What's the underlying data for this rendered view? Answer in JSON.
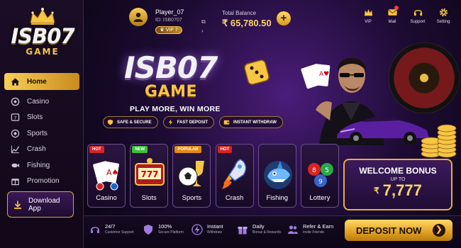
{
  "brand": {
    "logo_main": "ISB07",
    "logo_sub": "GAME"
  },
  "sidebar": {
    "items": [
      {
        "label": "Home",
        "icon": "home-icon",
        "active": true
      },
      {
        "label": "Casino",
        "icon": "casino-chip-icon"
      },
      {
        "label": "Slots",
        "icon": "slots-icon"
      },
      {
        "label": "Sports",
        "icon": "soccer-ball-icon"
      },
      {
        "label": "Crash",
        "icon": "chart-trend-icon"
      },
      {
        "label": "Fishing",
        "icon": "fish-icon"
      },
      {
        "label": "Promotion",
        "icon": "gift-icon"
      }
    ],
    "download_label_1": "Download",
    "download_label_2": "App"
  },
  "header": {
    "player_name": "Player_07",
    "player_id": "ID: ISB0707",
    "vip_level": "VIP 7",
    "balance_label": "Total Balance",
    "balance_value": "₹ 65,780.50",
    "add_label": "+",
    "icons": [
      {
        "label": "VIP",
        "icon": "crown-icon"
      },
      {
        "label": "Mail",
        "icon": "mail-icon"
      },
      {
        "label": "Support",
        "icon": "headset-icon"
      },
      {
        "label": "Setting",
        "icon": "gear-icon"
      }
    ]
  },
  "hero": {
    "title": "ISB07",
    "subtitle": "GAME",
    "tagline": "PLAY MORE, WIN MORE",
    "features": [
      "SAFE & SECURE",
      "FAST DEPOSIT",
      "INSTANT WITHDRAW"
    ]
  },
  "games": [
    {
      "name": "Casino",
      "badge": "HOT",
      "badge_type": "hot"
    },
    {
      "name": "Slots",
      "badge": "NEW",
      "badge_type": "new"
    },
    {
      "name": "Sports",
      "badge": "POPULAR",
      "badge_type": "popular"
    },
    {
      "name": "Crash",
      "badge": "HOT",
      "badge_type": "hot"
    },
    {
      "name": "Fishing",
      "badge": "",
      "badge_type": ""
    },
    {
      "name": "Lottery",
      "badge": "",
      "badge_type": ""
    }
  ],
  "bonus": {
    "title": "WELCOME BONUS",
    "upto": "UP TO",
    "currency": "₹",
    "amount": "7,777"
  },
  "perks": [
    {
      "title": "24/7",
      "sub": "Customer Support",
      "icon": "headset-icon"
    },
    {
      "title": "100%",
      "sub": "Secure Platform",
      "icon": "shield-icon"
    },
    {
      "title": "Instant",
      "sub": "Withdraw",
      "icon": "lightning-icon"
    },
    {
      "title": "Daily",
      "sub": "Bonus & Rewards",
      "icon": "gift-icon"
    },
    {
      "title": "Refer & Earn",
      "sub": "Invite Friends",
      "icon": "users-icon"
    }
  ],
  "cta": {
    "deposit_label": "DEPOSIT NOW",
    "arrow": "❯"
  },
  "colors": {
    "gold": "#f6c543",
    "purple": "#3c1a5c",
    "hot": "#d72424",
    "new": "#3ac03a",
    "popular": "#e28a12"
  }
}
